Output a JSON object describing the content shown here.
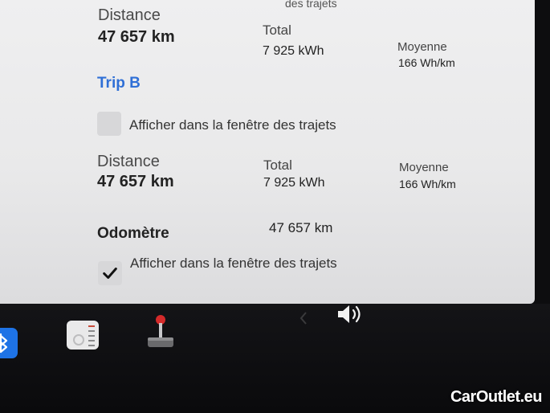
{
  "trip_a": {
    "show_label_partial": "des trajets",
    "distance_label": "Distance",
    "distance_value": "47 657 km",
    "total_label": "Total",
    "total_value": "7 925 kWh",
    "avg_label": "Moyenne",
    "avg_value": "166 Wh/km"
  },
  "trip_b": {
    "title": "Trip B",
    "show_label": "Afficher dans la fenêtre des trajets",
    "show_checked": false,
    "distance_label": "Distance",
    "distance_value": "47 657 km",
    "total_label": "Total",
    "total_value": "7 925 kWh",
    "avg_label": "Moyenne",
    "avg_value": "166 Wh/km"
  },
  "odometer": {
    "label": "Odomètre",
    "value": "47 657 km",
    "show_label": "Afficher dans la fenêtre des trajets",
    "show_checked": true
  },
  "taskbar": {
    "icons": [
      "bluetooth-icon",
      "radio-icon",
      "joystick-icon",
      "volume-icon"
    ]
  },
  "watermark": "CarOutlet.eu",
  "colors": {
    "accent": "#2f6fd6",
    "screen_bg": "#ececed",
    "taskbar_bg": "#0d0d0f",
    "bluetooth": "#1e73e6",
    "joystick_knob": "#d42a2a"
  }
}
